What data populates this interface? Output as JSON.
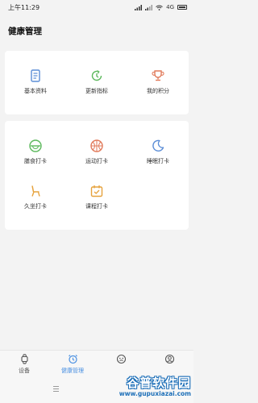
{
  "status": {
    "time": "上午11:29",
    "network": "4G"
  },
  "page": {
    "title": "健康管理"
  },
  "top_card": {
    "items": [
      {
        "label": "基本资料",
        "icon": "document-icon",
        "color": "#5b8dd6"
      },
      {
        "label": "更新指标",
        "icon": "refresh-clock-icon",
        "color": "#5cb85c"
      },
      {
        "label": "我的积分",
        "icon": "trophy-icon",
        "color": "#e17a5a"
      }
    ]
  },
  "checkin_card": {
    "items": [
      {
        "label": "膳食打卡",
        "icon": "bowl-icon",
        "color": "#5cb85c"
      },
      {
        "label": "运动打卡",
        "icon": "basketball-icon",
        "color": "#e17a5a"
      },
      {
        "label": "睡眠打卡",
        "icon": "moon-icon",
        "color": "#5b8dd6"
      },
      {
        "label": "久坐打卡",
        "icon": "chair-icon",
        "color": "#e6a23c"
      },
      {
        "label": "课程打卡",
        "icon": "calendar-check-icon",
        "color": "#e6a23c"
      }
    ]
  },
  "tabbar": {
    "tabs": [
      {
        "label": "设备",
        "icon": "watch-icon",
        "active": false
      },
      {
        "label": "健康管理",
        "icon": "alarm-clock-icon",
        "active": true
      },
      {
        "label": "",
        "icon": "face-icon",
        "active": false
      },
      {
        "label": "",
        "icon": "user-icon",
        "active": false
      }
    ],
    "active_color": "#4a90e2"
  },
  "watermark": {
    "title": "谷普软件园",
    "url": "www.gupuxiazai.com"
  }
}
